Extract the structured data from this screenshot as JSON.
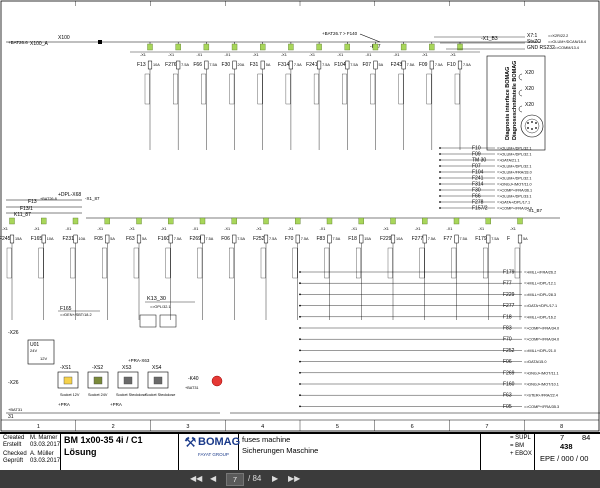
{
  "top_bus": {
    "supply_left": "+BAT26.6",
    "x100": "X100",
    "x100_label": "X100_A",
    "bat_f140": "+BAT26.7 > F140",
    "k67": "-K67",
    "x1_b3": "-X1_B3"
  },
  "right_connector": {
    "x7": "X7:1",
    "stvzo": "StvZO",
    "gnd_rs232": "GND RS232",
    "x7_ref": "=>X2R/22.2",
    "stvzo_ref": "=>OLUM+/DCAN/18.4",
    "gnd_ref": "=>COMM/13.4",
    "diag_title": "Diagnosis interface BOMAG",
    "diag_title_de": "Diagnoseschnittstelle BOMAG",
    "pins": [
      "X20",
      "X20",
      "X20"
    ]
  },
  "upper_fuses": [
    {
      "tag": "F13",
      "val": "10A"
    },
    {
      "tag": "F276",
      "val": "7.5A"
    },
    {
      "tag": "F66",
      "val": "7.5A"
    },
    {
      "tag": "F30",
      "val": "20A"
    },
    {
      "tag": "F31",
      "val": "5A"
    },
    {
      "tag": "F314",
      "val": "7.5A"
    },
    {
      "tag": "F241",
      "val": "7.5A"
    },
    {
      "tag": "F104",
      "val": "7.5A"
    },
    {
      "tag": "F07",
      "val": "5A"
    },
    {
      "tag": "F243",
      "val": "7.5A"
    },
    {
      "tag": "F09",
      "val": "7.5A"
    },
    {
      "tag": "F10",
      "val": "7.5A"
    }
  ],
  "upper_refs": [
    {
      "name": "F10",
      "ref": "=>OLUM+/DPL/32.1"
    },
    {
      "name": "F09",
      "ref": "=>OLUM+/DPL/32.1"
    },
    {
      "name": "TM 30",
      "ref": "=>DATA/21.1"
    },
    {
      "name": "F07",
      "ref": "=>OLUM+/DPL/32.1"
    },
    {
      "name": "F104",
      "ref": "=>OLUM+/FRA/33.0"
    },
    {
      "name": "F241",
      "ref": "=>OLUM+/DPL/32.1"
    },
    {
      "name": "F314",
      "ref": "=>DNGJ+/MOT/11.0"
    },
    {
      "name": "F30",
      "ref": "=>COMP+/FRA/36.1"
    },
    {
      "name": "F66",
      "ref": "=>OLUM+/DPL/33.1"
    },
    {
      "name": "F278",
      "ref": "=>DATA+/DPL/17.1"
    },
    {
      "name": "F157/2",
      "ref": "=>COMP+/FRA/34.0"
    }
  ],
  "left_mid": {
    "f13": "F13",
    "f13_1": "F13/1",
    "k11_87": "K11_87",
    "dpl": "+DPL-X68",
    "bat26": "+BAT26.8",
    "x1_87": "-X1_87",
    "x1_b7": "-X1_B7"
  },
  "lower_fuses": [
    {
      "tag": "F245",
      "val": "15A"
    },
    {
      "tag": "F165",
      "val": "10A"
    },
    {
      "tag": "F231",
      "val": "10A"
    },
    {
      "tag": "F05",
      "val": "5A"
    },
    {
      "tag": "F63",
      "val": "5A"
    },
    {
      "tag": "F160",
      "val": "7.5A"
    },
    {
      "tag": "F269",
      "val": "7.5A"
    },
    {
      "tag": "F06",
      "val": "7.5A"
    },
    {
      "tag": "F252",
      "val": "7.5A"
    },
    {
      "tag": "F70",
      "val": "7.5A"
    },
    {
      "tag": "F83",
      "val": "7.5A"
    },
    {
      "tag": "F18",
      "val": "15A"
    },
    {
      "tag": "F229",
      "val": "10A"
    },
    {
      "tag": "F277",
      "val": "7.5A"
    },
    {
      "tag": "F77",
      "val": "7.5A"
    },
    {
      "tag": "F179",
      "val": "7.5A"
    },
    {
      "tag": "F",
      "val": "5A"
    }
  ],
  "lower_refs": [
    {
      "name": "F179",
      "ref": "=>MILL+/FRA/26.2"
    },
    {
      "name": "F77",
      "ref": "=>MILL+/DPL/12.1"
    },
    {
      "name": "F229",
      "ref": "=>MILL+/DPL/28.3"
    },
    {
      "name": "F277",
      "ref": "=>DATA+/DPL/17.1"
    },
    {
      "name": "F18",
      "ref": "=>MILL+/DPL/16.2"
    },
    {
      "name": "F83",
      "ref": "=>COMP+/FRA/34.0"
    },
    {
      "name": "F70",
      "ref": "=>COMP+/FRA/34.0"
    },
    {
      "name": "F252",
      "ref": "=>MILL+/DPL/21.0"
    },
    {
      "name": "F06",
      "ref": "=>DATA/15.0"
    },
    {
      "name": "F269",
      "ref": "=>DNGJ+/MOT/11.1"
    },
    {
      "name": "F160",
      "ref": "=>DNGJ+/MOT/10.1"
    },
    {
      "name": "F63",
      "ref": "=>STER+/FRA/22.4"
    },
    {
      "name": "F05",
      "ref": "=>COMP+/FRA/35.3"
    }
  ],
  "lower_left": {
    "f165": "F165",
    "f165_ref": "=>DEN+/SBT/18.2",
    "k13": "K13_30",
    "k13_ref": "=>OPL/32.1",
    "x26": "-X26",
    "u01": "U01",
    "xs1": "-XS1",
    "xs2": "-XS2",
    "xs3": "XS3",
    "xs4": "XS4",
    "k40": "-K40",
    "bat": "+BAT31",
    "x31": "31",
    "socket_a": "Socket 12V",
    "socket_b": "Socket 24V",
    "socket_c": "Socket Steckdose",
    "pra1": "+PRA",
    "pra2": "+PRA",
    "pra3": "+PRA-X63",
    "v24": "24V",
    "v12": "12V"
  },
  "frame": {
    "columns": [
      "1",
      "2",
      "3",
      "4",
      "5",
      "6",
      "7",
      "8"
    ]
  },
  "title_block": {
    "created_label": "Created",
    "created_de": "Erstellt",
    "checked_label": "Checked",
    "checked_de": "Geprüft",
    "creator": "M. Marner",
    "creator_date": "03.03.2017",
    "checker": "A. Müller",
    "checker_date": "03.03.2017",
    "model": "BM 1x00-35 4i / C1",
    "solution": "Lösung",
    "brand": "BOMAG",
    "brand_sub": "FAYAT GROUP",
    "desc_en": "fuses machine",
    "desc_de": "Sicherungen Maschine",
    "code1": "= SUPL",
    "code2": "= BM",
    "code3": "+ EBOX",
    "sheet_no": "7",
    "sheet_total": "84",
    "doc_no": "438",
    "doc_code": "EPE / 000 / 00"
  },
  "viewer": {
    "page_current": "7",
    "page_total": "/ 84",
    "first": "◀◀",
    "prev": "◀",
    "next": "▶",
    "last": "▶▶"
  }
}
